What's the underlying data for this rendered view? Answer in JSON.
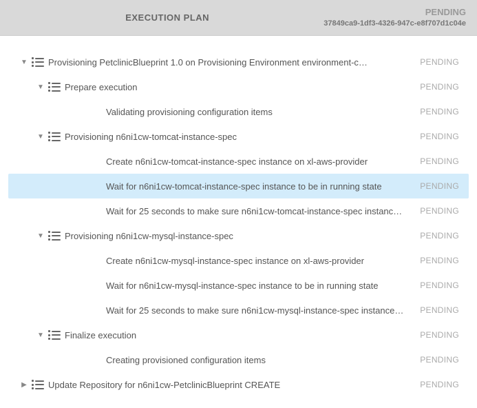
{
  "header": {
    "title": "EXECUTION PLAN",
    "status": "PENDING",
    "uuid": "37849ca9-1df3-4326-947c-e8f707d1c04e"
  },
  "rows": [
    {
      "indent": 0,
      "chevron": "down",
      "icon": true,
      "label": "Provisioning PetclinicBlueprint 1.0 on Provisioning Environment environment-c…",
      "status": "PENDING",
      "selected": false
    },
    {
      "indent": 1,
      "chevron": "down",
      "icon": true,
      "label": "Prepare execution",
      "status": "PENDING",
      "selected": false
    },
    {
      "indent": 3,
      "chevron": "none",
      "icon": false,
      "label": "Validating provisioning configuration items",
      "status": "PENDING",
      "selected": false
    },
    {
      "indent": 1,
      "chevron": "down",
      "icon": true,
      "label": "Provisioning n6ni1cw-tomcat-instance-spec",
      "status": "PENDING",
      "selected": false
    },
    {
      "indent": 3,
      "chevron": "none",
      "icon": false,
      "label": "Create n6ni1cw-tomcat-instance-spec instance on xl-aws-provider",
      "status": "PENDING",
      "selected": false
    },
    {
      "indent": 3,
      "chevron": "none",
      "icon": false,
      "label": "Wait for n6ni1cw-tomcat-instance-spec instance to be in running state",
      "status": "PENDING",
      "selected": true
    },
    {
      "indent": 3,
      "chevron": "none",
      "icon": false,
      "label": "Wait for 25 seconds to make sure n6ni1cw-tomcat-instance-spec instanc…",
      "status": "PENDING",
      "selected": false
    },
    {
      "indent": 1,
      "chevron": "down",
      "icon": true,
      "label": "Provisioning n6ni1cw-mysql-instance-spec",
      "status": "PENDING",
      "selected": false
    },
    {
      "indent": 3,
      "chevron": "none",
      "icon": false,
      "label": "Create n6ni1cw-mysql-instance-spec instance on xl-aws-provider",
      "status": "PENDING",
      "selected": false
    },
    {
      "indent": 3,
      "chevron": "none",
      "icon": false,
      "label": "Wait for n6ni1cw-mysql-instance-spec instance to be in running state",
      "status": "PENDING",
      "selected": false
    },
    {
      "indent": 3,
      "chevron": "none",
      "icon": false,
      "label": "Wait for 25 seconds to make sure n6ni1cw-mysql-instance-spec instance…",
      "status": "PENDING",
      "selected": false
    },
    {
      "indent": 1,
      "chevron": "down",
      "icon": true,
      "label": "Finalize execution",
      "status": "PENDING",
      "selected": false
    },
    {
      "indent": 3,
      "chevron": "none",
      "icon": false,
      "label": "Creating provisioned configuration items",
      "status": "PENDING",
      "selected": false
    },
    {
      "indent": 0,
      "chevron": "right",
      "icon": true,
      "label": "Update Repository for n6ni1cw-PetclinicBlueprint CREATE",
      "status": "PENDING",
      "selected": false
    }
  ]
}
